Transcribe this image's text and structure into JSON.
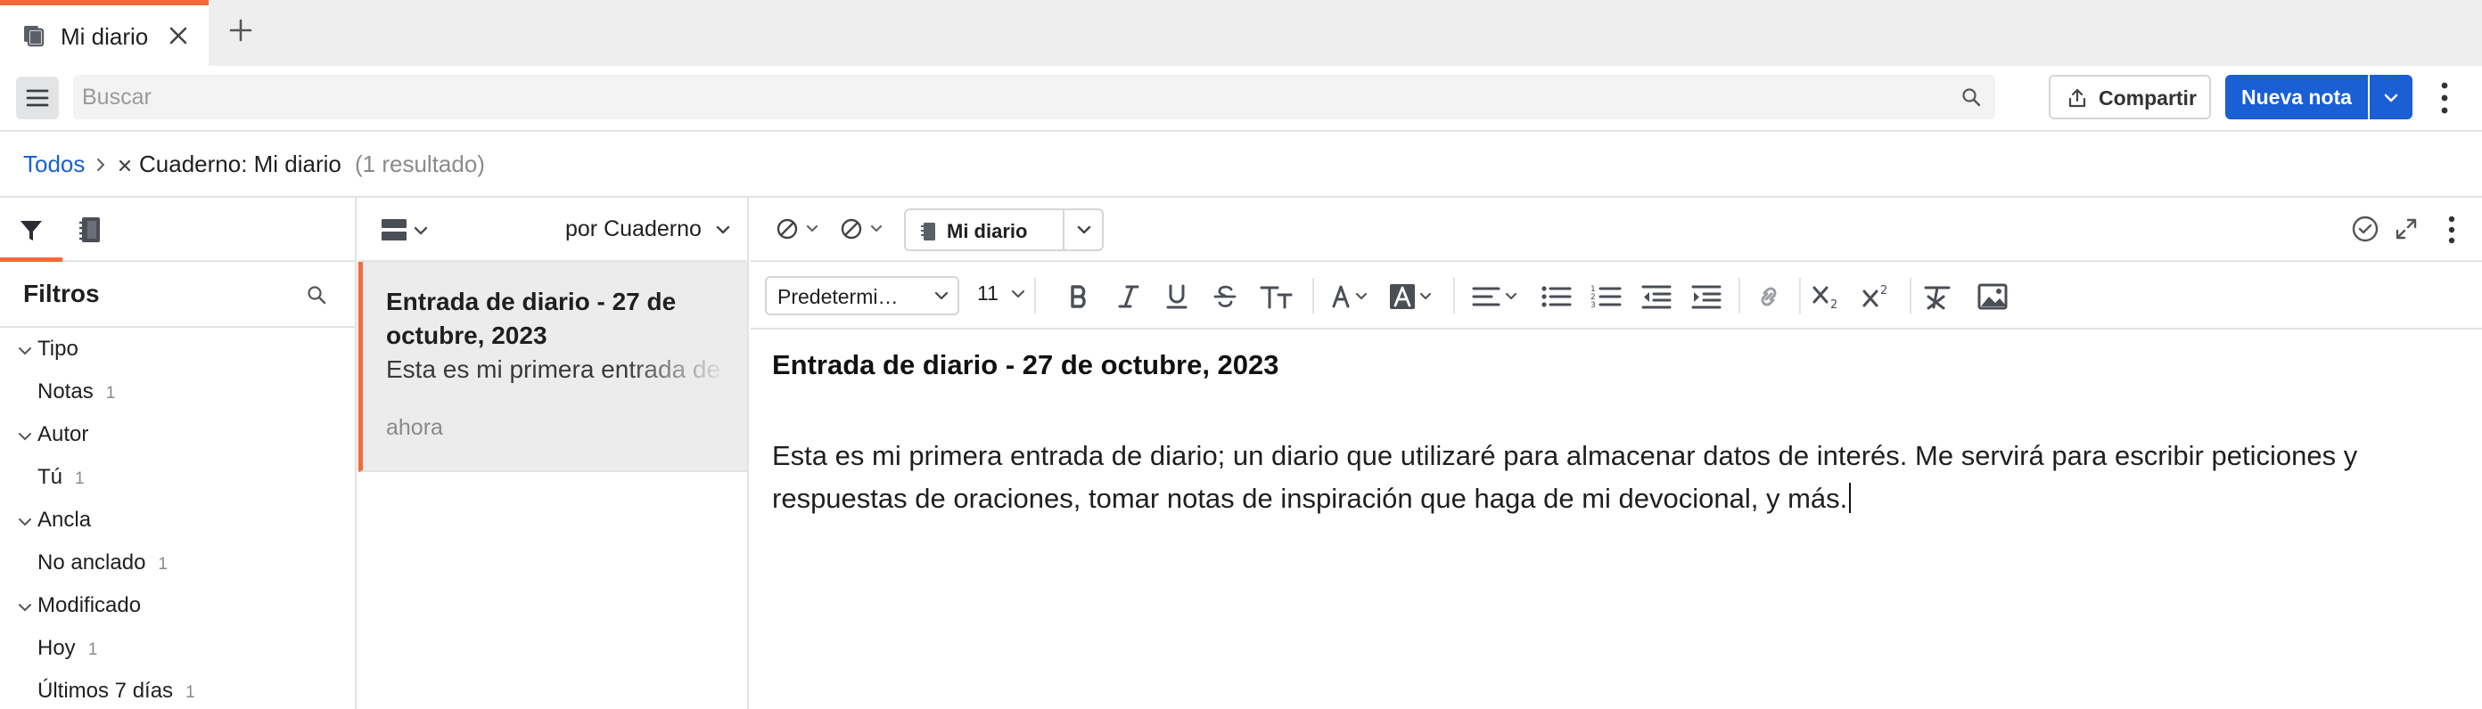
{
  "tab": {
    "title": "Mi diario"
  },
  "toolbar": {
    "search_placeholder": "Buscar",
    "share_label": "Compartir",
    "new_note_label": "Nueva nota"
  },
  "breadcrumb": {
    "all": "Todos",
    "notebook": "Cuaderno: Mi diario",
    "count": "(1 resultado)"
  },
  "filters": {
    "title": "Filtros",
    "groups": [
      {
        "label": "Tipo",
        "items": [
          {
            "label": "Notas",
            "count": "1"
          }
        ]
      },
      {
        "label": "Autor",
        "items": [
          {
            "label": "Tú",
            "count": "1"
          }
        ]
      },
      {
        "label": "Ancla",
        "items": [
          {
            "label": "No anclado",
            "count": "1"
          }
        ]
      },
      {
        "label": "Modificado",
        "items": [
          {
            "label": "Hoy",
            "count": "1"
          },
          {
            "label": "Últimos 7 días",
            "count": "1"
          }
        ]
      }
    ]
  },
  "notelist": {
    "sort_label": "por Cuaderno",
    "notes": [
      {
        "title": "Entrada de diario - 27 de octubre, 2023",
        "snippet": "Esta es mi primera entrada de diario",
        "time": "ahora"
      }
    ]
  },
  "editor": {
    "notebook_label": "Mi diario",
    "font": "Predetermi…",
    "size": "11",
    "doc_title": "Entrada de diario - 27 de octubre, 2023",
    "doc_body": "Esta es mi primera entrada de diario; un diario que utilizaré para almacenar datos de interés. Me servirá para escribir peticiones y respuestas de oraciones, tomar notas de inspiración que haga de mi devocional, y más."
  },
  "colors": {
    "accent_orange": "#f26b38",
    "primary_blue": "#1a5fd4"
  }
}
